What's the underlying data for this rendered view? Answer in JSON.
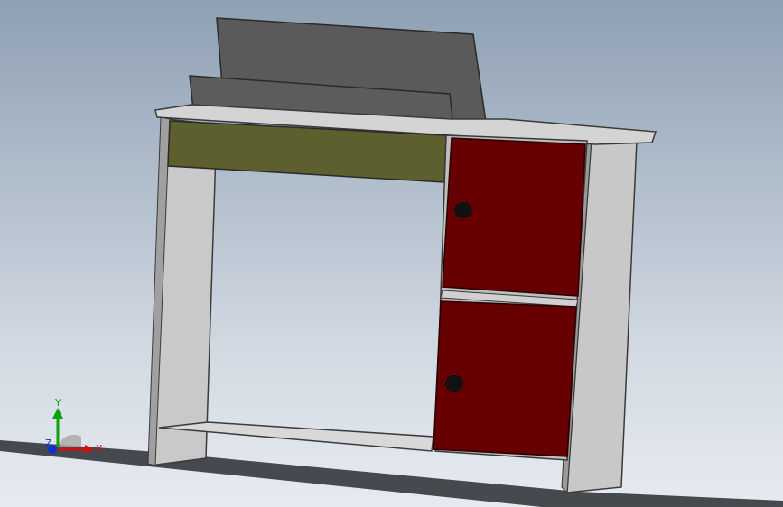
{
  "viewport": {
    "background_top": "#8fa0b4",
    "background_bottom": "#e6ebf0"
  },
  "model": {
    "colors": {
      "panel": "#c9c9c9",
      "panel_edge": "#3a3a3a",
      "drawer": "#5e5f2e",
      "door": "#660000",
      "hutch": "#5a5a5a",
      "knob": "#111111"
    }
  },
  "triad": {
    "x_label": "X",
    "y_label": "Y",
    "z_label": "Z",
    "x_color": "#d01010",
    "y_color": "#10a010",
    "z_color": "#1030d0"
  }
}
